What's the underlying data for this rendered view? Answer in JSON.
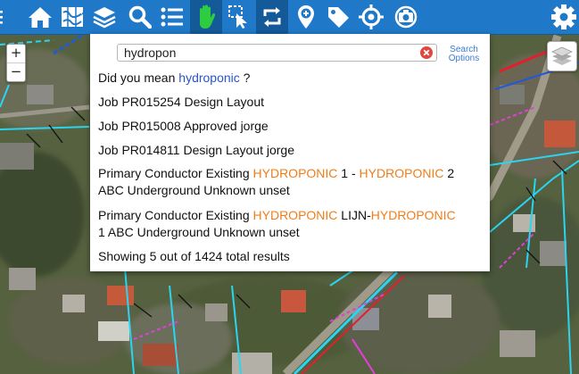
{
  "search": {
    "query": "hydropon",
    "options_label_1": "Search",
    "options_label_2": "Options"
  },
  "did_you_mean": {
    "prefix": "Did you mean",
    "suggestion": "hydroponic",
    "suffix": "?"
  },
  "results": [
    {
      "text": "Job PR015254 Design Layout"
    },
    {
      "text": "Job PR015008 Approved jorge"
    },
    {
      "text": "Job PR014811 Design Layout jorge"
    },
    {
      "parts": [
        "Primary Conductor Existing ",
        "HYDROPONIC",
        " 1 - ",
        "HYDROPONIC",
        " 2",
        "ABC Underground Unknown unset"
      ]
    },
    {
      "parts": [
        "Primary Conductor Existing ",
        "HYDROPONIC",
        " LIJN-",
        "HYDROPONIC",
        "",
        "1 ABC Underground Unknown unset"
      ]
    }
  ],
  "summary": "Showing 5 out of 1424 total results",
  "zoom": {
    "in": "+",
    "out": "−"
  },
  "toolbar": {
    "icons": [
      "menu-icon",
      "home-icon",
      "map-icon",
      "layers-icon",
      "search-icon",
      "list-icon",
      "hand-icon",
      "select-pointer-icon",
      "sync-icon",
      "add-location-icon",
      "tag-icon",
      "crosshair-icon",
      "camera-location-icon",
      "settings-icon"
    ],
    "active": "hand-icon",
    "accent": "#1f78c8",
    "hand_color": "#2ecc40"
  },
  "colors": {
    "highlight": "#f07d1a",
    "suggestion": "#2a55c8",
    "link": "#3a7bd5"
  }
}
